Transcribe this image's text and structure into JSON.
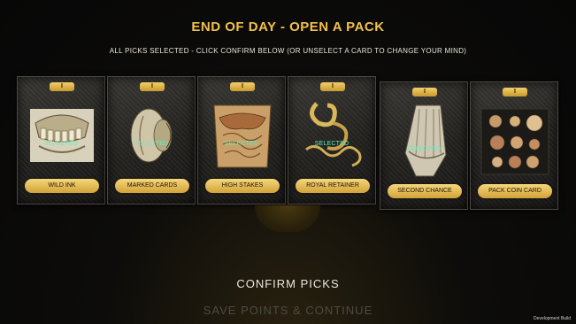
{
  "header": {
    "title": "END OF DAY  -  OPEN A PACK",
    "subtitle": "ALL PICKS SELECTED  -  CLICK CONFIRM BELOW  (OR UNSELECT A CARD TO CHANGE YOUR MIND)"
  },
  "cards": [
    {
      "tab": "I",
      "label": "WILD INK",
      "status": "SELECTED",
      "icon": "teeth-skull-illustration"
    },
    {
      "tab": "I",
      "label": "MARKED CARDS",
      "status": "SELECTED",
      "icon": "kidney-illustration"
    },
    {
      "tab": "I",
      "label": "HIGH STAKES",
      "status": "SELECTED",
      "icon": "torso-illustration"
    },
    {
      "tab": "I",
      "label": "ROYAL RETAINER",
      "status": "SELECTED",
      "icon": "intestine-illustration"
    },
    {
      "tab": "I",
      "label": "SECOND CHANCE",
      "status": "SELECTED",
      "icon": "hand-muscles-illustration"
    },
    {
      "tab": "I",
      "label": "PACK COIN CARD",
      "status": "",
      "icon": "specimen-plate-illustration"
    }
  ],
  "actions": {
    "confirm_label": "CONFIRM PICKS",
    "save_label": "SAVE POINTS & CONTINUE"
  },
  "footer": {
    "build_label": "Development Build"
  },
  "colors": {
    "title_gold": "#f2c14a",
    "selected_green": "#5ff0c0",
    "button_gold": "#e6bd55"
  }
}
